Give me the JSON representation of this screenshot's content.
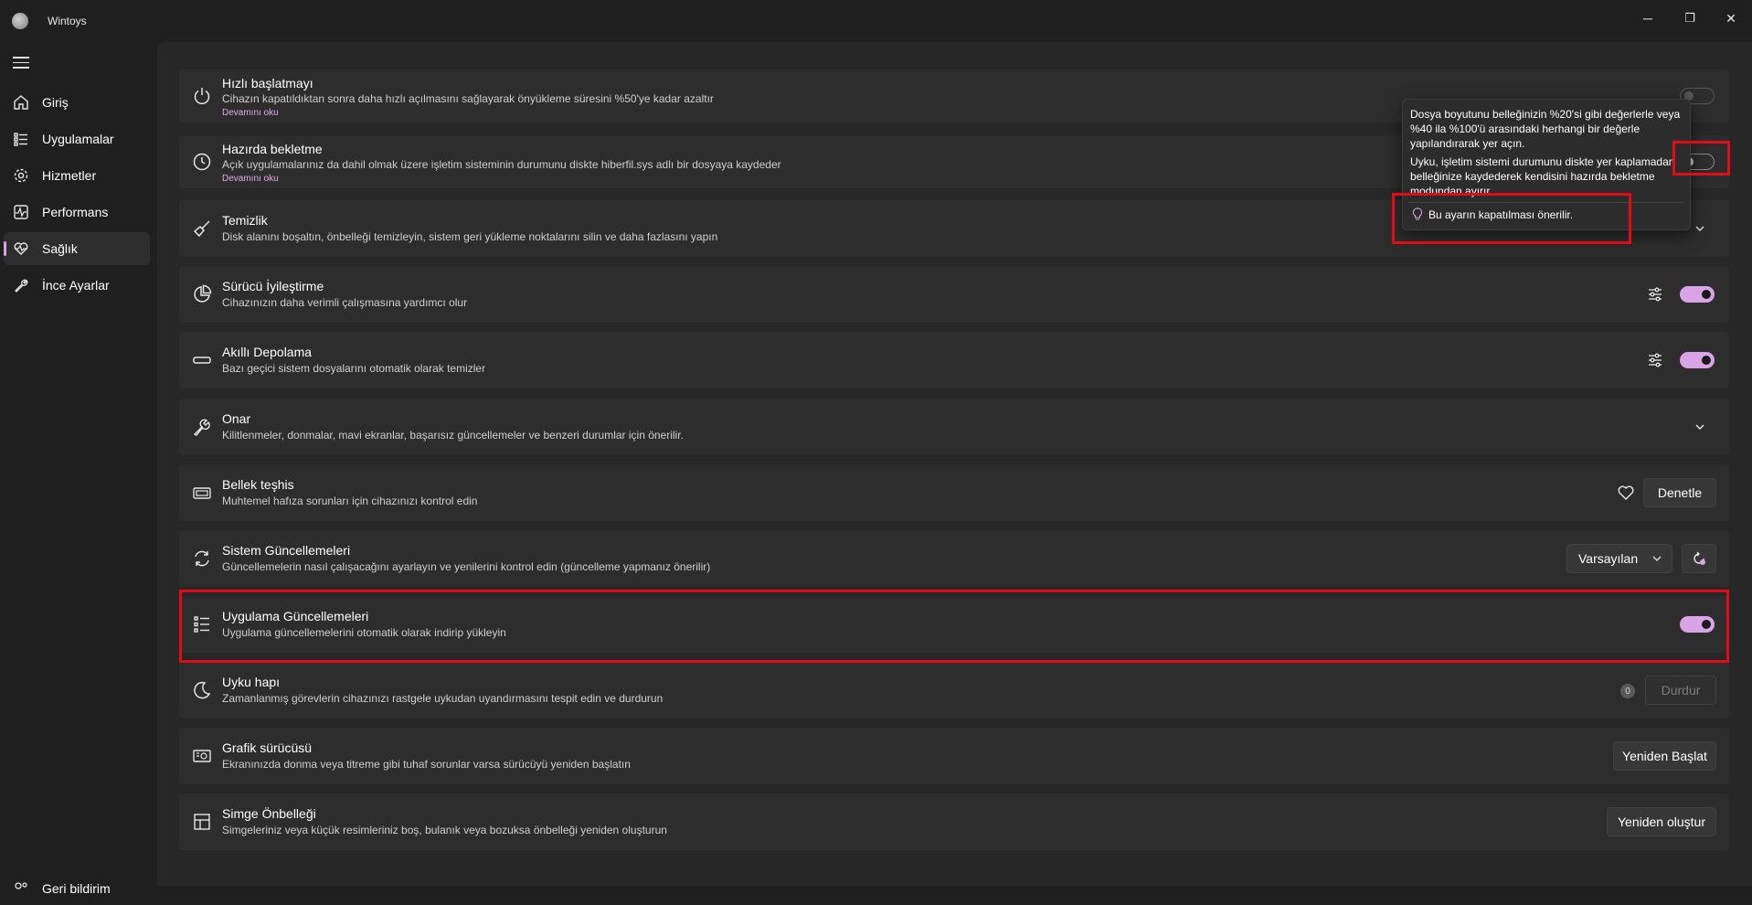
{
  "window": {
    "title": "Wintoys",
    "minimize": "─",
    "maximize": "❐",
    "close": "✕"
  },
  "sidebar": {
    "items": [
      {
        "label": "Giriş",
        "icon": "home-icon"
      },
      {
        "label": "Uygulamalar",
        "icon": "apps-list-icon"
      },
      {
        "label": "Hizmetler",
        "icon": "gear-icon"
      },
      {
        "label": "Performans",
        "icon": "pulse-icon"
      },
      {
        "label": "Sağlık",
        "icon": "heart-pulse-icon",
        "active": true
      },
      {
        "label": "İnce Ayarlar",
        "icon": "wrench-icon"
      }
    ],
    "feedback_label": "Geri bildirim"
  },
  "accent_color": "#d8a4e6",
  "highlight_color": "#e10c16",
  "settings": [
    {
      "title": "Hızlı başlatmayı",
      "desc": "Cihazın kapatıldıktan sonra daha hızlı açılmasını sağlayarak önyükleme süresini %50'ye kadar azaltır",
      "more": "Devamını oku",
      "control": "toggle",
      "state": "disabled"
    },
    {
      "title": "Hazırda bekletme",
      "desc": "Açık uygulamalarınız da dahil olmak üzere işletim sisteminin durumunu diskte hiberfil.sys adlı bir dosyaya kaydeder",
      "more": "Devamını oku",
      "control": "toggle",
      "state": "off"
    },
    {
      "title": "Temizlik",
      "desc": "Disk alanını boşaltın, önbelleği temizleyin, sistem geri yükleme noktalarını silin ve daha fazlasını yapın",
      "control": "expand"
    },
    {
      "title": "Sürücü İyileştirme",
      "desc": "Cihazınızın daha verimli çalışmasına yardımcı olur",
      "control": "toggle",
      "state": "on"
    },
    {
      "title": "Akıllı Depolama",
      "desc": "Bazı geçici sistem dosyalarını otomatik olarak temizler",
      "control": "toggle",
      "state": "on"
    },
    {
      "title": "Onar",
      "desc": "Kilitlenmeler, donmalar, mavi ekranlar, başarısız güncellemeler ve benzeri durumlar için önerilir.",
      "control": "expand"
    },
    {
      "title": "Bellek teşhis",
      "desc": "Muhtemel hafıza sorunları için cihazınızı kontrol edin",
      "control": "button",
      "button": "Denetle"
    },
    {
      "title": "Sistem Güncellemeleri",
      "desc": "Güncellemelerin nasıl çalışacağını ayarlayın ve yenilerini kontrol edin (güncelleme yapmanız önerilir)",
      "control": "select",
      "select_value": "Varsayılan"
    },
    {
      "title": "Uygulama Güncellemeleri",
      "desc": "Uygulama güncellemelerini otomatik olarak indirip yükleyin",
      "control": "toggle",
      "state": "on"
    },
    {
      "title": "Uyku hapı",
      "desc": "Zamanlanmış görevlerin cihazınızı rastgele uykudan uyandırmasını tespit edin ve durdurun",
      "control": "button",
      "button": "Durdur",
      "badge": "0"
    },
    {
      "title": "Grafik sürücüsü",
      "desc": "Ekranınızda donma veya titreme gibi tuhaf sorunlar varsa sürücüyü yeniden başlatın",
      "control": "button",
      "button": "Yeniden Başlat"
    },
    {
      "title": "Simge Önbelleği",
      "desc": "Simgeleriniz veya küçük resimleriniz boş, bulanık veya bozuksa önbelleği yeniden oluşturun",
      "control": "button",
      "button": "Yeniden oluştur"
    }
  ],
  "tooltip": {
    "line1": "Dosya boyutunu belleğinizin %20'si gibi değerlerle veya %40 ila %100'ü arasındaki herhangi bir değerle yapılandırarak yer açın.",
    "line2": "Uyku, işletim sistemi durumunu diskte yer kaplamadan belleğinize kaydederek kendisini hazırda bekletme modundan ayırır.",
    "hint": "Bu ayarın kapatılması önerilir."
  }
}
